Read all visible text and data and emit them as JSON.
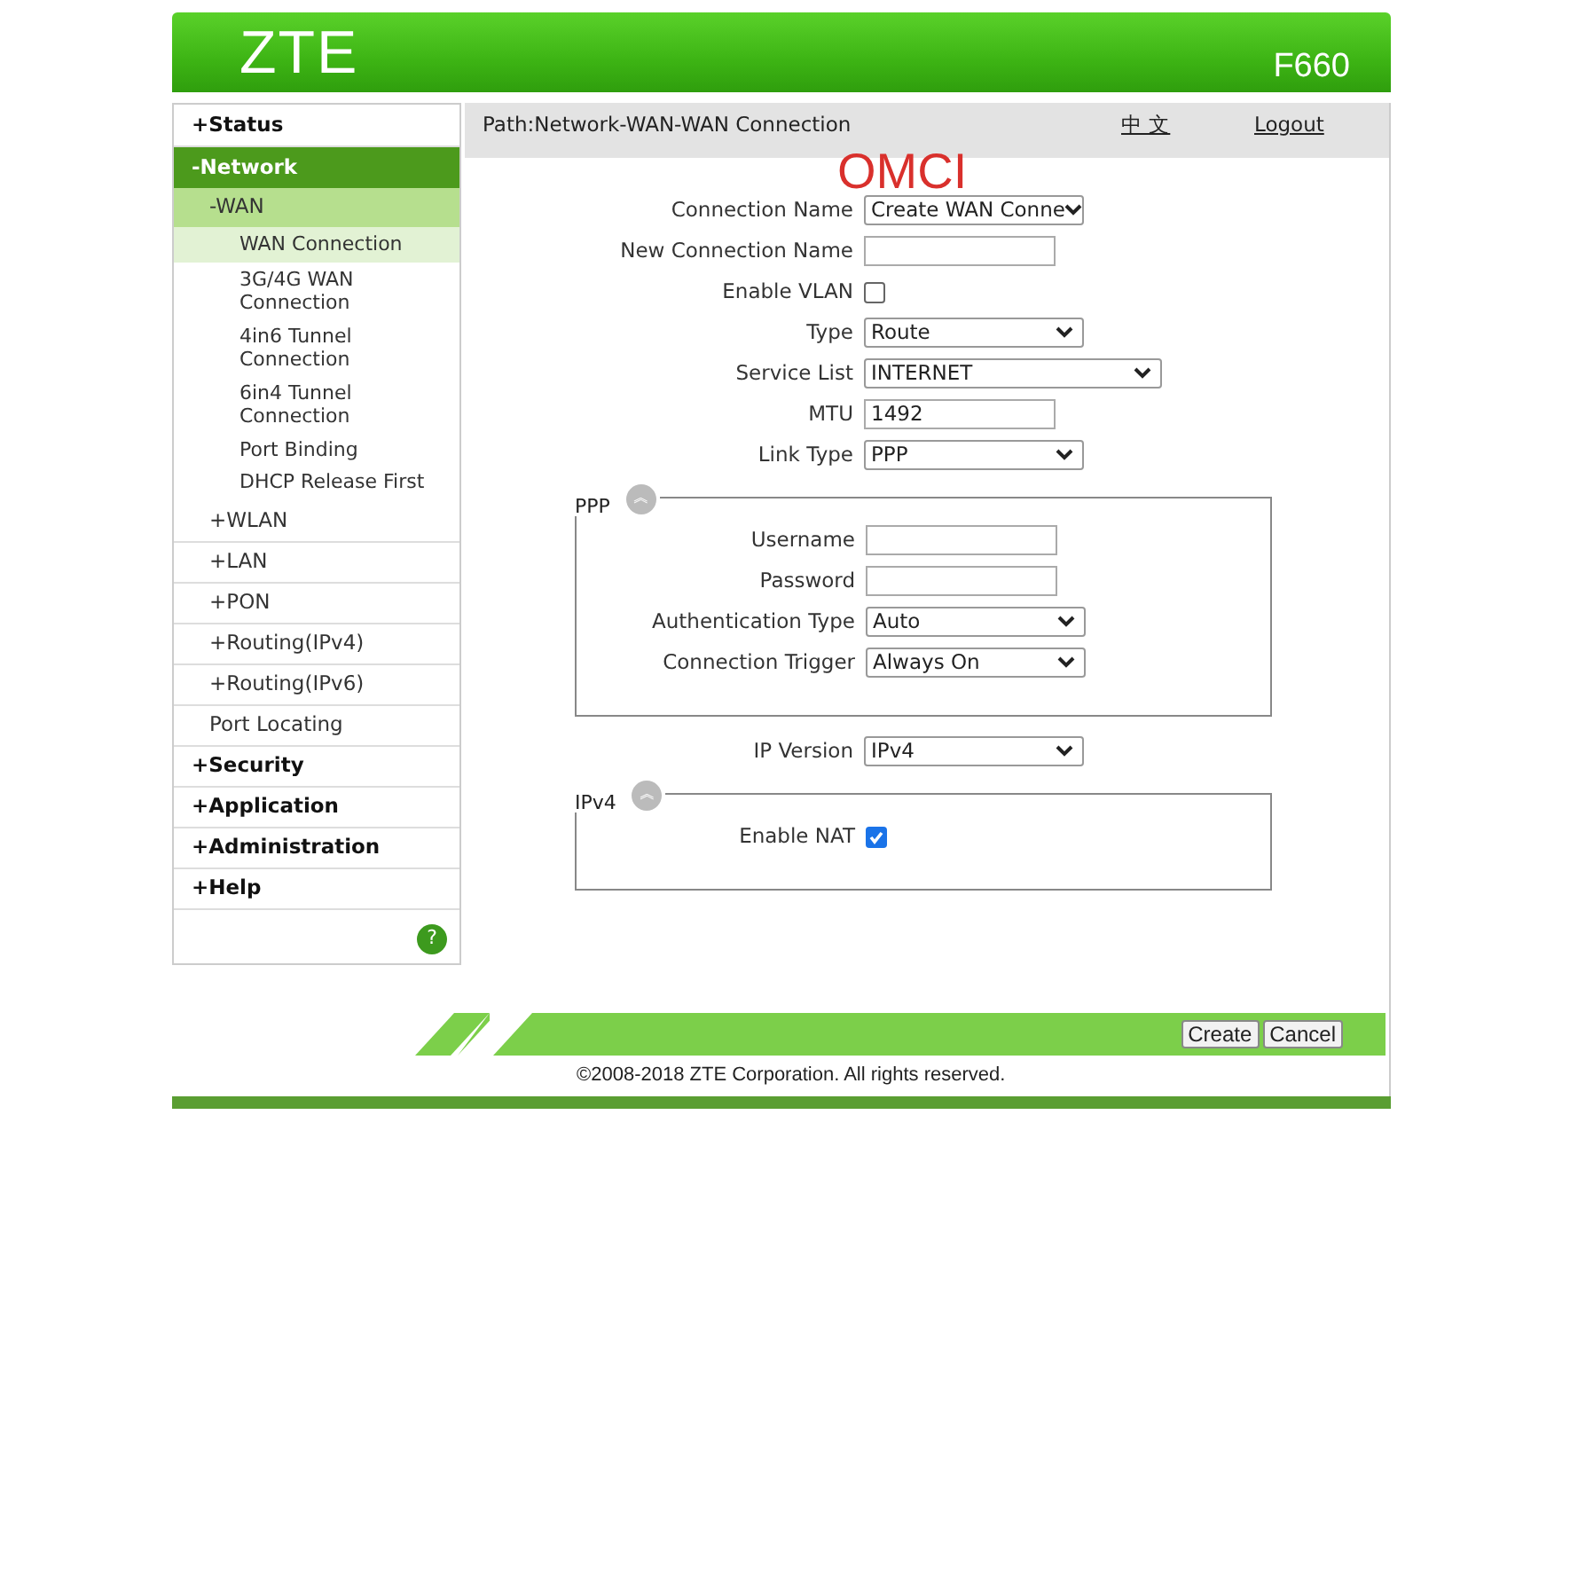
{
  "header": {
    "logo": "ZTE",
    "model": "F660"
  },
  "sidebar": {
    "items": [
      {
        "label": "+Status",
        "selected": false
      },
      {
        "label": "-Network",
        "selected": true,
        "children": [
          {
            "label": "-WAN",
            "selected": true,
            "children": [
              {
                "label": "WAN Connection",
                "selected": true
              },
              {
                "label": "3G/4G WAN Connection",
                "selected": false
              },
              {
                "label": "4in6 Tunnel Connection",
                "selected": false
              },
              {
                "label": "6in4 Tunnel Connection",
                "selected": false
              },
              {
                "label": "Port Binding",
                "selected": false
              },
              {
                "label": "DHCP Release First",
                "selected": false
              }
            ]
          },
          {
            "label": "+WLAN",
            "selected": false
          },
          {
            "label": "+LAN",
            "selected": false
          },
          {
            "label": "+PON",
            "selected": false
          },
          {
            "label": "+Routing(IPv4)",
            "selected": false
          },
          {
            "label": "+Routing(IPv6)",
            "selected": false
          },
          {
            "label": "Port Locating",
            "selected": false
          }
        ]
      },
      {
        "label": "+Security",
        "selected": false
      },
      {
        "label": "+Application",
        "selected": false
      },
      {
        "label": "+Administration",
        "selected": false
      },
      {
        "label": "+Help",
        "selected": false
      }
    ],
    "help_icon": "?"
  },
  "path_bar": {
    "path": "Path:Network-WAN-WAN Connection",
    "language_link": "中 文",
    "logout_link": "Logout"
  },
  "annotation": "OMCI",
  "form": {
    "fields": [
      {
        "kind": "select",
        "label": "Connection Name",
        "value": "Create WAN Conne"
      },
      {
        "kind": "text",
        "label": "New Connection Name"
      },
      {
        "kind": "checkbox",
        "label": "Enable VLAN",
        "checked": false
      },
      {
        "kind": "select",
        "label": "Type",
        "value": "Route"
      },
      {
        "kind": "wide-select",
        "label": "Service List",
        "value": "INTERNET"
      },
      {
        "kind": "text",
        "label": "MTU",
        "value": "1492"
      },
      {
        "kind": "select",
        "label": "Link Type",
        "value": "PPP"
      },
      {
        "kind": "fieldset",
        "title": "PPP",
        "collapse_icon": "︽",
        "fields": [
          {
            "kind": "text",
            "label": "Username"
          },
          {
            "kind": "text",
            "label": "Password"
          },
          {
            "kind": "select",
            "label": "Authentication Type",
            "value": "Auto"
          },
          {
            "kind": "select",
            "label": "Connection Trigger",
            "value": "Always On"
          }
        ]
      },
      {
        "kind": "select",
        "label": "IP Version",
        "value": "IPv4"
      },
      {
        "kind": "fieldset",
        "title": "IPv4",
        "collapse_icon": "︽",
        "fields": [
          {
            "kind": "checkbox",
            "label": "Enable NAT",
            "checked": true
          }
        ]
      }
    ]
  },
  "buttons": [
    "Create",
    "Cancel"
  ],
  "footer": "©2008-2018 ZTE Corporation. All rights reserved."
}
